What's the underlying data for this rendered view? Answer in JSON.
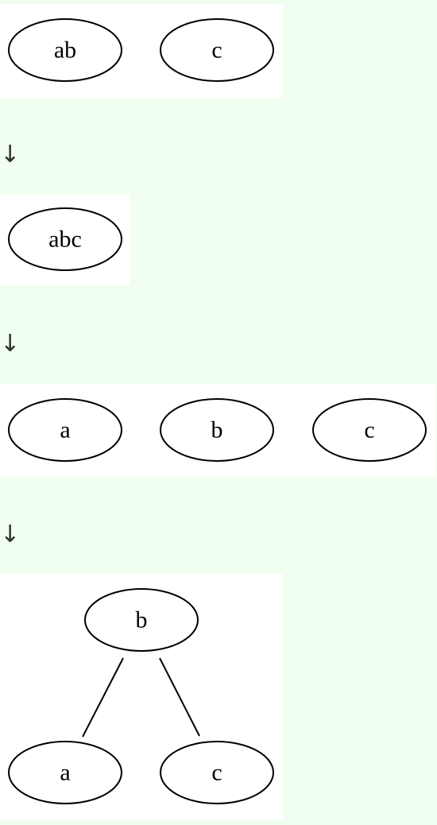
{
  "step1": {
    "node_ab": "ab",
    "node_c": "c"
  },
  "arrow1": "↓",
  "step2": {
    "node_abc": "abc"
  },
  "arrow2": "↓",
  "step3": {
    "node_a": "a",
    "node_b": "b",
    "node_c": "c"
  },
  "arrow3": "↓",
  "step4": {
    "node_b": "b",
    "node_a": "a",
    "node_c": "c"
  }
}
